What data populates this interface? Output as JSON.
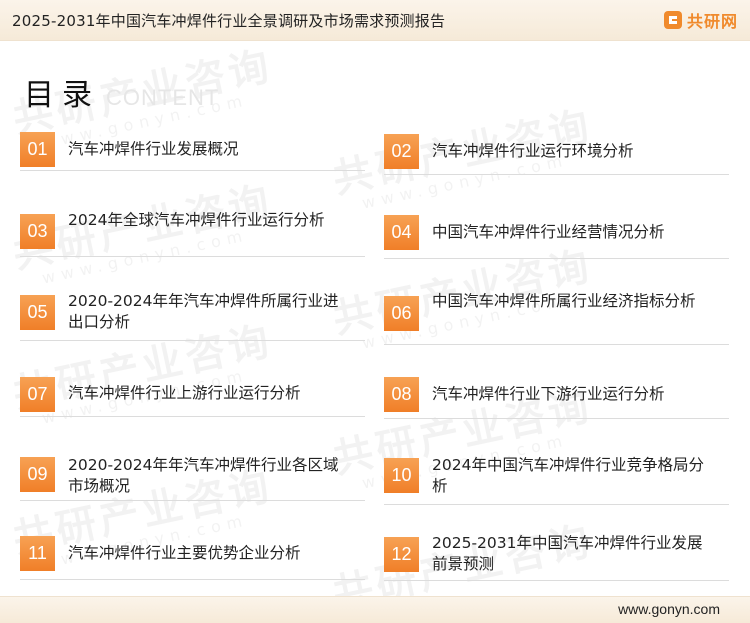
{
  "header": {
    "title": "2025-2031年中国汽车冲焊件行业全景调研及市场需求预测报告",
    "logo_text": "共研网"
  },
  "toc": {
    "title": "目录",
    "subtitle": "CONTENT"
  },
  "watermark": {
    "text": "共研产业咨询",
    "url": "www.gonyn.com"
  },
  "items": [
    {
      "num": "01",
      "label": "汽车冲焊件行业发展概况"
    },
    {
      "num": "02",
      "label": "汽车冲焊件行业运行环境分析"
    },
    {
      "num": "03",
      "label": "2024年全球汽车冲焊件行业运行分析"
    },
    {
      "num": "04",
      "label": "中国汽车冲焊件行业经营情况分析"
    },
    {
      "num": "05",
      "label": "2020-2024年年汽车冲焊件所属行业进出口分析"
    },
    {
      "num": "06",
      "label": "中国汽车冲焊件所属行业经济指标分析"
    },
    {
      "num": "07",
      "label": "汽车冲焊件行业上游行业运行分析"
    },
    {
      "num": "08",
      "label": "汽车冲焊件行业下游行业运行分析"
    },
    {
      "num": "09",
      "label": "2020-2024年年汽车冲焊件行业各区域市场概况"
    },
    {
      "num": "10",
      "label": "2024年中国汽车冲焊件行业竞争格局分析"
    },
    {
      "num": "11",
      "label": "汽车冲焊件行业主要优势企业分析"
    },
    {
      "num": "12",
      "label": "2025-2031年中国汽车冲焊件行业发展前景预测"
    }
  ],
  "footer": {
    "url": "www.gonyn.com"
  },
  "colors": {
    "accent": "#f08a2c",
    "bar_bg": "#f8efe2"
  }
}
